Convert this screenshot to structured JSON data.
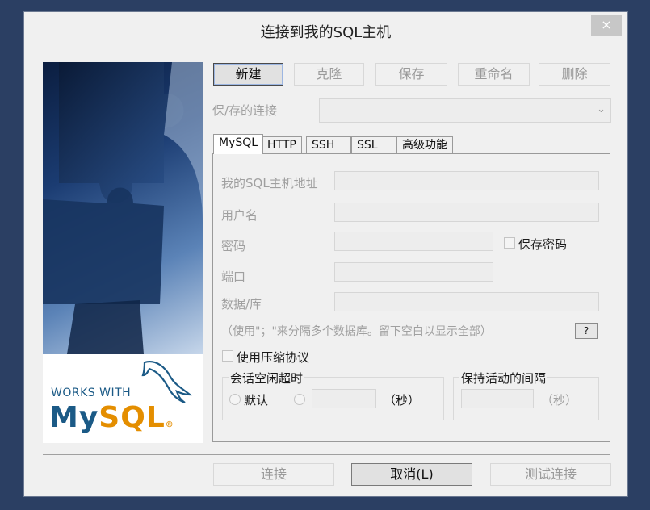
{
  "dialog": {
    "title": "连接到我的SQL主机",
    "close_label": "×"
  },
  "hero": {
    "works_with": "WORKS WITH",
    "mysql_prefix": "My",
    "mysql_suffix": "SQL",
    "trademark": "®"
  },
  "toolbar": {
    "new_label": "新建",
    "clone_label": "克隆",
    "save_label": "保存",
    "rename_label": "重命名",
    "delete_label": "删除"
  },
  "saved_connections": {
    "label": "保/存的连接",
    "value": ""
  },
  "tabs": [
    {
      "label": "MySQL"
    },
    {
      "label": "HTTP"
    },
    {
      "label": "SSH"
    },
    {
      "label": "SSL"
    },
    {
      "label": "高级功能"
    }
  ],
  "form": {
    "host_label": "我的SQL主机地址",
    "host_value": "",
    "user_label": "用户名",
    "user_value": "",
    "password_label": "密码",
    "password_value": "",
    "save_password_label": "保存密码",
    "port_label": "端口",
    "port_value": "",
    "database_label": "数据/库",
    "database_value": "",
    "database_hint": "（使用\"；\"来分隔多个数据库。留下空白以显示全部）",
    "help_label": "?",
    "compression_label": "使用压缩协议"
  },
  "session_timeout": {
    "title": "会话空闲超时",
    "default_label": "默认",
    "custom_value": "",
    "unit_label": "（秒）"
  },
  "keepalive": {
    "title": "保持活动的间隔",
    "value": "",
    "unit_label": "（秒）"
  },
  "footer": {
    "connect_label": "连接",
    "cancel_label": "取消(L)",
    "test_label": "测试连接"
  }
}
